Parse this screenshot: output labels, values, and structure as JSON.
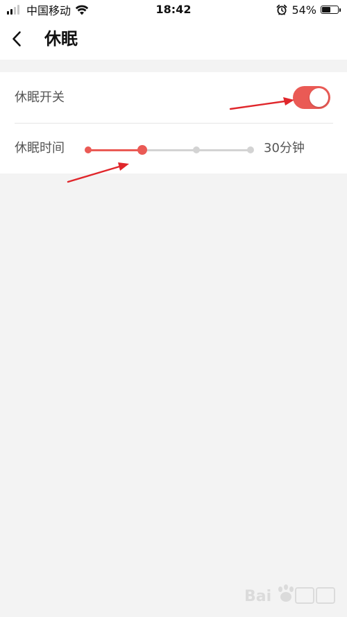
{
  "status_bar": {
    "carrier": "中国移动",
    "time": "18:42",
    "battery_percent": "54%",
    "battery_level": 0.54,
    "signal_bars_active": 2,
    "signal_bars_total": 4,
    "icons": [
      "signal-icon",
      "wifi-icon",
      "alarm-icon",
      "battery-icon"
    ]
  },
  "header": {
    "back_icon": "chevron-left-icon",
    "title": "休眠"
  },
  "settings": {
    "sleep_switch": {
      "label": "休眠开关",
      "on": true
    },
    "sleep_time": {
      "label": "休眠时间",
      "value_label": "30分钟",
      "steps": 4,
      "selected_index": 1
    }
  },
  "colors": {
    "accent": "#ea5a55",
    "inactive": "#d3d3d3",
    "background": "#f3f3f3",
    "card": "#ffffff",
    "annotation_arrow": "#e0262b"
  },
  "watermark_icon": "baidu-jingyan-logo"
}
